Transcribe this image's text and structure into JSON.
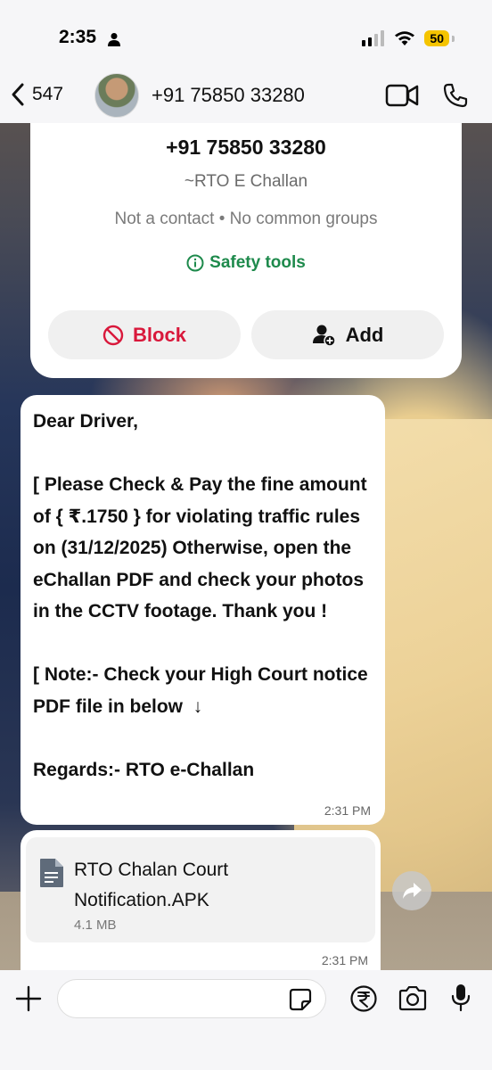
{
  "status_bar": {
    "time": "2:35",
    "battery": "50"
  },
  "header": {
    "back_count": "547",
    "title": "+91 75850 33280"
  },
  "contact_card": {
    "number": "+91 75850 33280",
    "name": "~RTO E Challan",
    "meta": "Not a contact • No common groups",
    "safety_label": "Safety tools",
    "block_label": "Block",
    "add_label": "Add"
  },
  "message": {
    "text": "Dear Driver,\n\n[ Please Check & Pay the fine amount of { ₹.1750 } for violating traffic rules on (31/12/2025) Otherwise, open the eChallan PDF and check your photos in the CCTV footage. Thank you !\n\n[ Note:- Check your High Court notice PDF file in below  ↓\n\nRegards:- RTO e-Challan",
    "time": "2:31 PM"
  },
  "file_message": {
    "file_name": "RTO Chalan Court Notification.APK",
    "file_size": "4.1 MB",
    "time": "2:31 PM"
  },
  "input_bar": {
    "placeholder": ""
  },
  "colors": {
    "block_red": "#d9183b",
    "safety_green": "#1e8a4c",
    "battery_yellow": "#f5c400"
  }
}
